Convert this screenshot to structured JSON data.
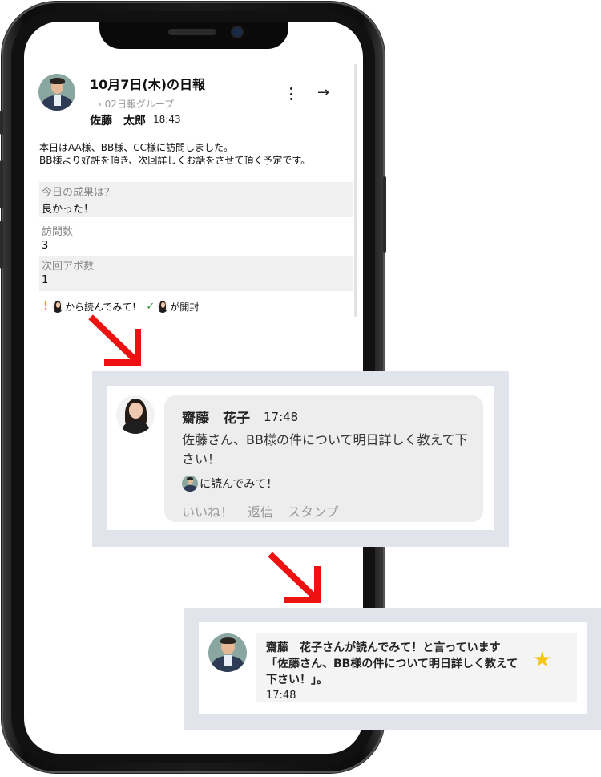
{
  "report": {
    "title": "10月7日(木)の日報",
    "group": "›  02日報グループ",
    "author": "佐藤　太郎",
    "time": "18:43",
    "body_line1": "本日はAA様、BB様、CC様に訪問しました。",
    "body_line2": "BB様より好評を頂き、次回詳しくお話をさせて頂く予定です。",
    "fields": [
      {
        "label": "今日の成果は？",
        "value": "良かった！"
      },
      {
        "label": "訪問数",
        "value": "3"
      },
      {
        "label": "次回アポ数",
        "value": "1"
      }
    ],
    "status_request": "から読んでみて！",
    "status_opened": "が開封",
    "icons": {
      "more": "more-vertical-icon",
      "forward": "arrow-right-icon",
      "request": "exclamation-icon",
      "opened": "checkmark-icon"
    }
  },
  "comment": {
    "author": "齋藤　花子",
    "time": "17:48",
    "text": "佐藤さん、BB様の件について明日詳しく教えて下さい！",
    "request": "に読んでみて！",
    "actions": [
      "いいね！",
      "返信",
      "スタンプ"
    ]
  },
  "notification": {
    "text": "齋藤　花子さんが読んでみて！と言っています「佐藤さん、BB様の件について明日詳しく教えて下さい！」。",
    "time": "17:48",
    "icon": "star-icon"
  },
  "colors": {
    "accent_arrow": "#ee1111",
    "star": "#f5c518",
    "excl": "#f2a520",
    "check": "#2e9b3c"
  }
}
